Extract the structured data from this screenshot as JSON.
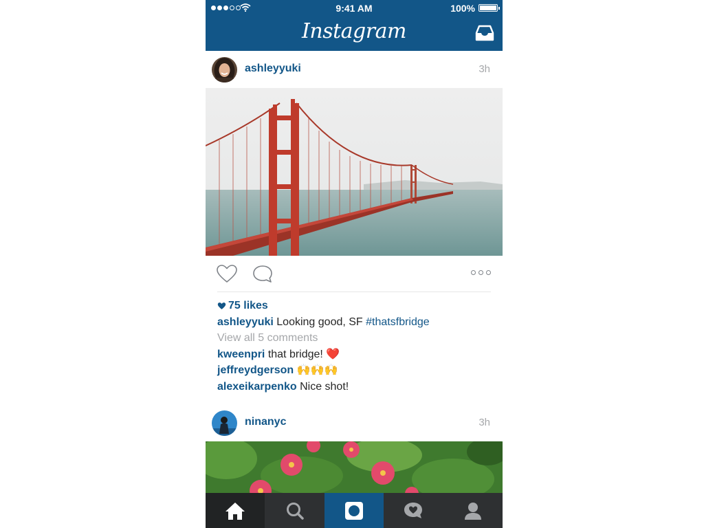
{
  "status_bar": {
    "time": "9:41 AM",
    "battery": "100%"
  },
  "app": {
    "title": "Instagram"
  },
  "posts": [
    {
      "username": "ashleyyuki",
      "time_ago": "3h",
      "likes": "75 likes",
      "caption_user": "ashleyyuki",
      "caption_text": "Looking good, SF",
      "caption_hashtag": "#thatsfbridge",
      "view_comments": "View all 5 comments",
      "comments": [
        {
          "user": "kweenpri",
          "text": "that bridge! ❤️"
        },
        {
          "user": "jeffreydgerson",
          "text": "🙌🙌🙌"
        },
        {
          "user": "alexeikarpenko",
          "text": "Nice shot!"
        }
      ]
    },
    {
      "username": "ninanyc",
      "time_ago": "3h"
    }
  ],
  "tab_bar": {
    "items": [
      "home",
      "search",
      "camera",
      "activity",
      "profile"
    ],
    "active": "home"
  },
  "colors": {
    "brand": "#125688",
    "tab_bar": "#2e3032",
    "muted": "#a5a7aa",
    "like_red": "#e0242c"
  }
}
